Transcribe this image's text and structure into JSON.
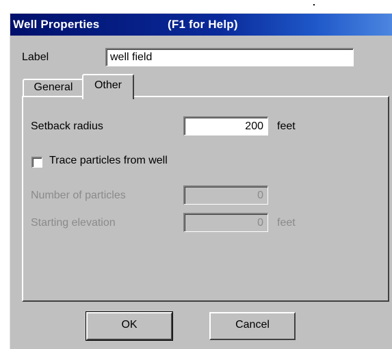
{
  "window": {
    "title": "Well Properties",
    "help_hint": "(F1 for Help)"
  },
  "label_field": {
    "label": "Label",
    "value": "well field"
  },
  "tabs": [
    {
      "label": "General",
      "active": false
    },
    {
      "label": "Other",
      "active": true
    }
  ],
  "other_tab": {
    "setback_radius": {
      "label": "Setback radius",
      "value": "200",
      "unit": "feet"
    },
    "trace_particles": {
      "label": "Trace particles from well",
      "checked": false
    },
    "number_of_particles": {
      "label": "Number of particles",
      "value": "0",
      "enabled": false
    },
    "starting_elevation": {
      "label": "Starting elevation",
      "value": "0",
      "unit": "feet",
      "enabled": false
    }
  },
  "buttons": {
    "ok": "OK",
    "cancel": "Cancel"
  }
}
